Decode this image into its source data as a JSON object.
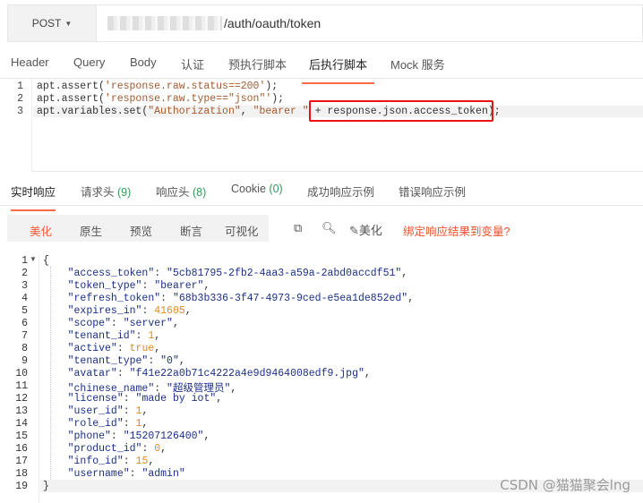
{
  "request": {
    "method": "POST",
    "url_visible": "/auth/oauth/token"
  },
  "request_tabs": [
    "Header",
    "Query",
    "Body",
    "认证",
    "预执行脚本",
    "后执行脚本",
    "Mock 服务"
  ],
  "active_request_tab": "后执行脚本",
  "script": {
    "line_numbers": [
      "1",
      "2",
      "3"
    ],
    "line1_a": "apt.assert(",
    "line1_s": "'response.raw.status==200'",
    "line1_b": ");",
    "line2_a": "apt.assert(",
    "line2_s": "'response.raw.type==\"json\"'",
    "line2_b": ");",
    "line3_a": "apt.variables.set(",
    "line3_s1": "\"Authorization\"",
    "line3_mid": ", ",
    "line3_s2": "\"bearer \"",
    "line3_plus": " + ",
    "line3_expr": "response.json.access_token);"
  },
  "response_tabs": [
    {
      "label": "实时响应",
      "count": ""
    },
    {
      "label": "请求头",
      "count": "(9)"
    },
    {
      "label": "响应头",
      "count": "(8)"
    },
    {
      "label": "Cookie",
      "count": "(0)"
    },
    {
      "label": "成功响应示例",
      "count": ""
    },
    {
      "label": "错误响应示例",
      "count": ""
    }
  ],
  "toolbar": {
    "views": [
      "美化",
      "原生",
      "预览",
      "断言",
      "可视化"
    ],
    "active_view": "美化",
    "beautify_label": "美化",
    "bind_link": "绑定响应结果到变量?"
  },
  "response_body": {
    "line_numbers": [
      "1",
      "2",
      "3",
      "4",
      "5",
      "6",
      "7",
      "8",
      "9",
      "10",
      "11",
      "12",
      "13",
      "14",
      "15",
      "16",
      "17",
      "18",
      "19"
    ],
    "open_brace": "{",
    "close_brace": "}",
    "fields": [
      {
        "key": "\"access_token\"",
        "value": "\"5cb81795-2fb2-4aa3-a59a-2abd0accdf51\"",
        "type": "string"
      },
      {
        "key": "\"token_type\"",
        "value": "\"bearer\"",
        "type": "string"
      },
      {
        "key": "\"refresh_token\"",
        "value": "\"68b3b336-3f47-4973-9ced-e5ea1de852ed\"",
        "type": "string"
      },
      {
        "key": "\"expires_in\"",
        "value": "41605",
        "type": "number"
      },
      {
        "key": "\"scope\"",
        "value": "\"server\"",
        "type": "string"
      },
      {
        "key": "\"tenant_id\"",
        "value": "1",
        "type": "number"
      },
      {
        "key": "\"active\"",
        "value": "true",
        "type": "bool"
      },
      {
        "key": "\"tenant_type\"",
        "value": "\"0\"",
        "type": "string"
      },
      {
        "key": "\"avatar\"",
        "value": "\"f41e22a0b71c4222a4e9d9464008edf9.jpg\"",
        "type": "string"
      },
      {
        "key": "\"chinese_name\"",
        "value": "\"超级管理员\"",
        "type": "string"
      },
      {
        "key": "\"license\"",
        "value": "\"made by iot\"",
        "type": "string"
      },
      {
        "key": "\"user_id\"",
        "value": "1",
        "type": "number"
      },
      {
        "key": "\"role_id\"",
        "value": "1",
        "type": "number"
      },
      {
        "key": "\"phone\"",
        "value": "\"15207126400\"",
        "type": "string"
      },
      {
        "key": "\"product_id\"",
        "value": "0",
        "type": "number"
      },
      {
        "key": "\"info_id\"",
        "value": "15",
        "type": "number"
      },
      {
        "key": "\"username\"",
        "value": "\"admin\"",
        "type": "string"
      }
    ]
  },
  "watermark": "CSDN @猫猫聚会lng",
  "colors": {
    "accent": "#ff6a47",
    "highlight_box": "#e11111",
    "json_key": "#1b2f87",
    "json_number": "#e08a1e",
    "count_green": "#2f9a5a"
  }
}
